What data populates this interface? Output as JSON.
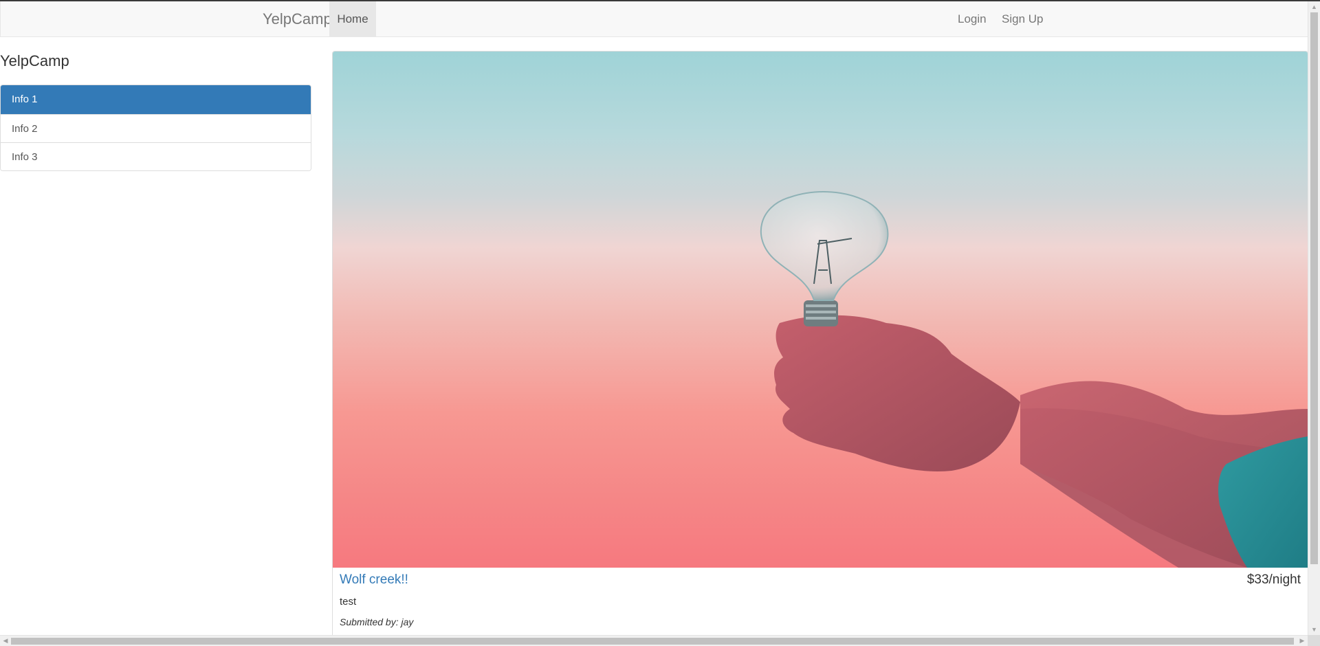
{
  "navbar": {
    "brand": "YelpCamp",
    "items": [
      {
        "label": "Home",
        "active": true
      }
    ],
    "right_items": [
      {
        "label": "Login"
      },
      {
        "label": "Sign Up"
      }
    ]
  },
  "sidebar": {
    "title": "YelpCamp",
    "items": [
      {
        "label": "Info 1",
        "active": true
      },
      {
        "label": "Info 2",
        "active": false
      },
      {
        "label": "Info 3",
        "active": false
      }
    ]
  },
  "campground": {
    "name": "Wolf creek!!",
    "price": "$33/night",
    "description": "test",
    "submitted_prefix": "Submitted by:",
    "author": "jay"
  },
  "colors": {
    "active_blue": "#337ab7",
    "link_blue": "#337ab7",
    "navbar_bg": "#f8f8f8"
  }
}
